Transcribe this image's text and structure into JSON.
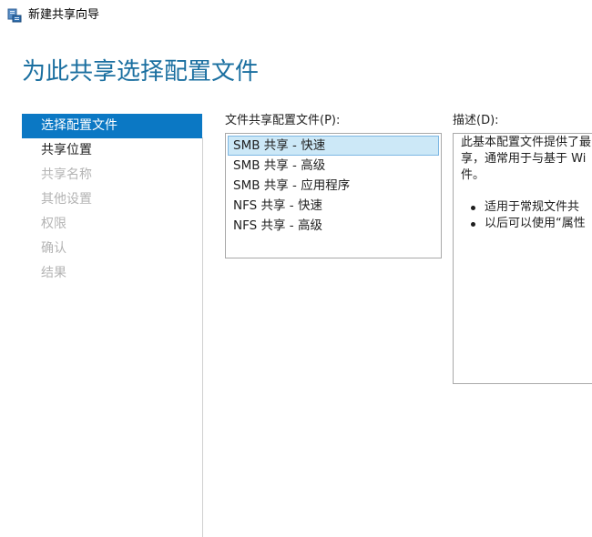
{
  "window": {
    "title": "新建共享向导",
    "app_icon": "share-wizard-icon"
  },
  "page_title": "为此共享选择配置文件",
  "nav": {
    "items": [
      {
        "label": "选择配置文件",
        "state": "active"
      },
      {
        "label": "共享位置",
        "state": "normal"
      },
      {
        "label": "共享名称",
        "state": "disabled"
      },
      {
        "label": "其他设置",
        "state": "disabled"
      },
      {
        "label": "权限",
        "state": "disabled"
      },
      {
        "label": "确认",
        "state": "disabled"
      },
      {
        "label": "结果",
        "state": "disabled"
      }
    ]
  },
  "profiles": {
    "label": "文件共享配置文件(P):",
    "items": [
      {
        "label": "SMB 共享 - 快速",
        "selected": true
      },
      {
        "label": "SMB 共享 - 高级",
        "selected": false
      },
      {
        "label": "SMB 共享 - 应用程序",
        "selected": false
      },
      {
        "label": "NFS 共享 - 快速",
        "selected": false
      },
      {
        "label": "NFS 共享 - 高级",
        "selected": false
      }
    ]
  },
  "description": {
    "label": "描述(D):",
    "lines": [
      "此基本配置文件提供了最",
      "享，通常用于与基于 Wi",
      "件。"
    ],
    "bullets": [
      "适用于常规文件共",
      "以后可以使用“属性"
    ]
  },
  "colors": {
    "accent": "#0b78c4",
    "title": "#1a6fa0",
    "selection_bg": "#cce8f7",
    "selection_border": "#7db7e3",
    "disabled_text": "#b4b4b4"
  }
}
